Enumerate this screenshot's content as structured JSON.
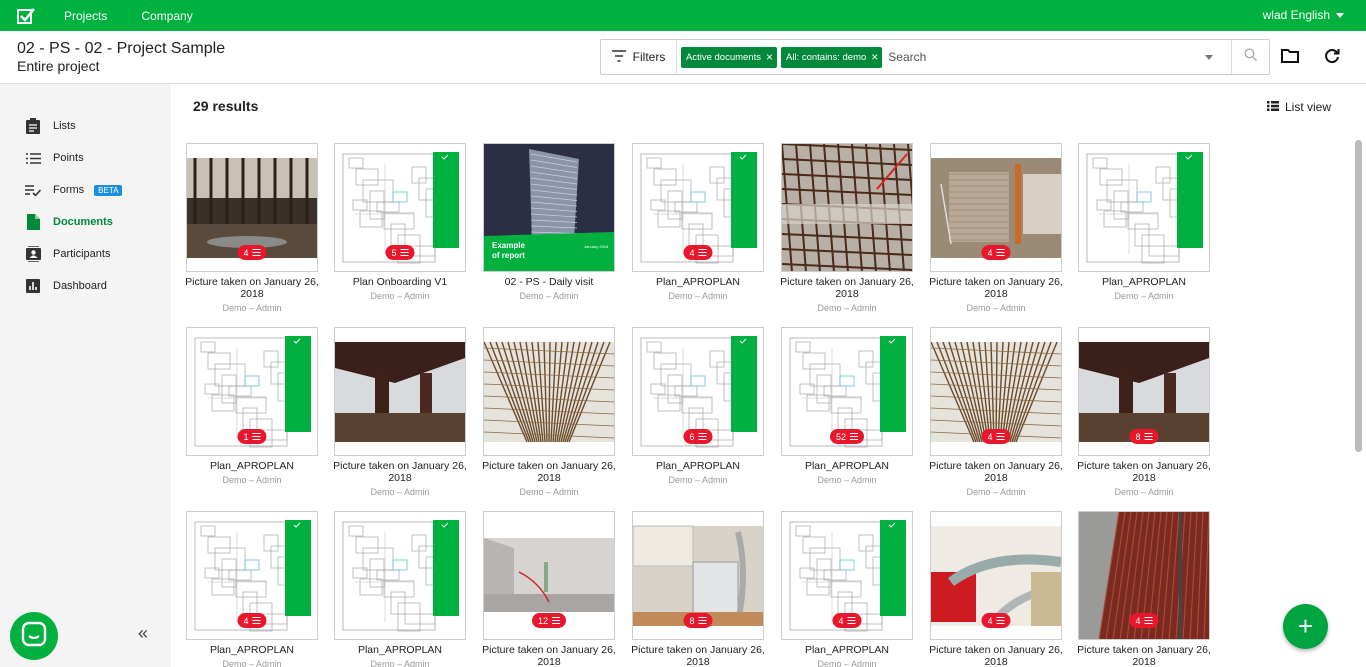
{
  "topbar": {
    "nav": [
      "Projects",
      "Company"
    ],
    "user": "wlad English"
  },
  "header": {
    "title": "02 - PS - 02 - Project Sample",
    "subtitle": "Entire project",
    "filters_label": "Filters",
    "chips": [
      "Active documents",
      "All: contains: demo"
    ],
    "search_placeholder": "Search"
  },
  "sidebar": {
    "items": [
      {
        "label": "Lists",
        "icon": "clipboard-icon"
      },
      {
        "label": "Points",
        "icon": "list-icon"
      },
      {
        "label": "Forms",
        "icon": "checklist-icon",
        "badge": "BETA"
      },
      {
        "label": "Documents",
        "icon": "document-icon",
        "active": true
      },
      {
        "label": "Participants",
        "icon": "contacts-icon"
      },
      {
        "label": "Dashboard",
        "icon": "chart-icon"
      }
    ]
  },
  "main": {
    "results": "29 results",
    "list_view_label": "List view"
  },
  "documents": [
    {
      "title": "Picture taken on January 26, 2018",
      "meta": "Demo – Admin",
      "badge": "4",
      "kind": "photo-construction"
    },
    {
      "title": "Plan Onboarding V1",
      "meta": "Demo – Admin",
      "badge": "5",
      "kind": "plan"
    },
    {
      "title": "02 - PS - Daily visit",
      "meta": "Demo – Admin",
      "badge": "",
      "kind": "report",
      "cover_text": "Example\nof report",
      "cover_date": "January 2018"
    },
    {
      "title": "Plan_APROPLAN",
      "meta": "Demo – Admin",
      "badge": "4",
      "kind": "plan"
    },
    {
      "title": "Picture taken on January 26, 2018",
      "meta": "Demo – Admin",
      "badge": "",
      "kind": "photo-rebar-floor"
    },
    {
      "title": "Picture taken on January 26, 2018",
      "meta": "Demo – Admin",
      "badge": "4",
      "kind": "photo-brick"
    },
    {
      "title": "Plan_APROPLAN",
      "meta": "Demo – Admin",
      "badge": "",
      "kind": "plan"
    },
    {
      "title": "Plan_APROPLAN",
      "meta": "Demo – Admin",
      "badge": "1",
      "kind": "plan"
    },
    {
      "title": "Picture taken on January 26, 2018",
      "meta": "Demo – Admin",
      "badge": "",
      "kind": "photo-beams"
    },
    {
      "title": "Picture taken on January 26, 2018",
      "meta": "Demo – Admin",
      "badge": "",
      "kind": "photo-rebar"
    },
    {
      "title": "Plan_APROPLAN",
      "meta": "Demo – Admin",
      "badge": "6",
      "kind": "plan"
    },
    {
      "title": "Plan_APROPLAN",
      "meta": "Demo – Admin",
      "badge": "52",
      "kind": "plan"
    },
    {
      "title": "Picture taken on January 26, 2018",
      "meta": "Demo – Admin",
      "badge": "4",
      "kind": "photo-rebar"
    },
    {
      "title": "Picture taken on January 26, 2018",
      "meta": "Demo – Admin",
      "badge": "8",
      "kind": "photo-beams"
    },
    {
      "title": "Plan_APROPLAN",
      "meta": "Demo – Admin",
      "badge": "4",
      "kind": "plan"
    },
    {
      "title": "Plan_APROPLAN",
      "meta": "Demo – Admin",
      "badge": "",
      "kind": "plan"
    },
    {
      "title": "Picture taken on January 26, 2018",
      "meta": "Demo – Admin",
      "badge": "12",
      "kind": "photo-room"
    },
    {
      "title": "Picture taken on January 26, 2018",
      "meta": "Demo – Admin",
      "badge": "8",
      "kind": "photo-hvac"
    },
    {
      "title": "Plan_APROPLAN",
      "meta": "Demo – Admin",
      "badge": "4",
      "kind": "plan"
    },
    {
      "title": "Picture taken on January 26, 2018",
      "meta": "Demo – Admin",
      "badge": "4",
      "kind": "photo-pipes"
    },
    {
      "title": "Picture taken on January 26, 2018",
      "meta": "Demo – Admin",
      "badge": "4",
      "kind": "photo-deck"
    }
  ],
  "colors": {
    "brand": "#00b140",
    "badge": "#e8172c",
    "chip": "#00893a",
    "beta": "#1e8fe0"
  }
}
